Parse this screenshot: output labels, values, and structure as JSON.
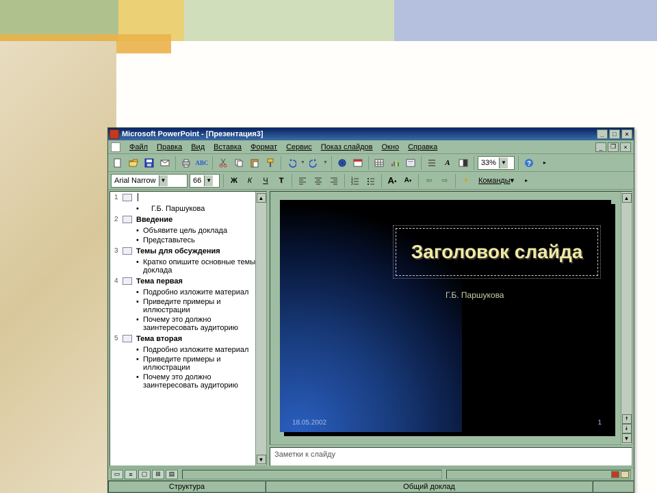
{
  "window": {
    "title": "Microsoft PowerPoint - [Презентация3]"
  },
  "menu": {
    "items": [
      "Файл",
      "Правка",
      "Вид",
      "Вставка",
      "Формат",
      "Сервис",
      "Показ слайдов",
      "Окно",
      "Справка"
    ]
  },
  "toolbar1_icons": [
    "new",
    "open",
    "save",
    "mail",
    "print",
    "spell",
    "cut",
    "copy",
    "paste",
    "format-painter",
    "undo",
    "redo",
    "link",
    "table",
    "grid",
    "chart",
    "new-slide",
    "promote",
    "demote",
    "text-color",
    "zoom",
    "help"
  ],
  "zoom": "33%",
  "toolbar2": {
    "font": "Arial Narrow",
    "size": "66",
    "icons": [
      "bold",
      "italic",
      "underline",
      "shadow",
      "align-left",
      "align-center",
      "align-right",
      "num-list",
      "bul-list",
      "inc-font",
      "dec-font",
      "promote",
      "demote",
      "effects"
    ],
    "commands_label": "Команды"
  },
  "outline": [
    {
      "n": "1",
      "title": "",
      "author": "Г.Б. Паршукова"
    },
    {
      "n": "2",
      "title": "Введение",
      "bullets": [
        "Объявите цель доклада",
        "Представьтесь"
      ]
    },
    {
      "n": "3",
      "title": "Темы для обсуждения",
      "bullets": [
        "Кратко опишите основные темы доклада"
      ]
    },
    {
      "n": "4",
      "title": "Тема первая",
      "bullets": [
        "Подробно изложите материал",
        "Приведите примеры и иллюстрации",
        "Почему это должно заинтересовать аудиторию"
      ]
    },
    {
      "n": "5",
      "title": "Тема вторая",
      "bullets": [
        "Подробно изложите материал",
        "Приведите примеры и иллюстрации",
        "Почему это должно заинтересовать аудиторию"
      ]
    }
  ],
  "slide": {
    "title": "Заголовок слайда",
    "subtitle": "Г.Б. Паршукова",
    "date": "18.05.2002",
    "page": "1"
  },
  "notes_placeholder": "Заметки к слайду",
  "status": {
    "left": "Структура",
    "center": "Общий доклад"
  }
}
